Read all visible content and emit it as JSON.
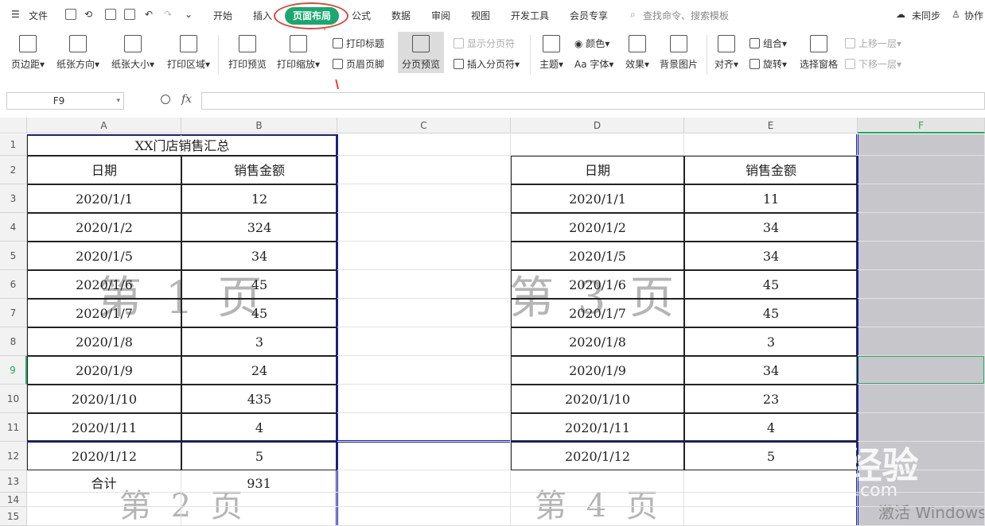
{
  "menu": {
    "file": "文件",
    "tabs": [
      "开始",
      "插入",
      "页面布局",
      "公式",
      "数据",
      "审阅",
      "视图",
      "开发工具",
      "会员专享"
    ],
    "search": "查找命令、搜索模板",
    "sync": "未同步",
    "collab": "协作"
  },
  "ribbon": {
    "margins": "页边距",
    "orientation": "纸张方向",
    "size": "纸张大小",
    "print_area": "打印区域",
    "print_preview": "打印预览",
    "print_scale": "打印缩放",
    "print_titles": "打印标题",
    "header_footer": "页眉页脚",
    "page_break_preview": "分页预览",
    "show_page_breaks": "显示分页符",
    "insert_page_break": "插入分页符",
    "theme": "主题",
    "colors": "颜色",
    "fonts": "字体",
    "effects": "效果",
    "background": "背景图片",
    "align": "对齐",
    "group": "组合",
    "rotate": "旋转",
    "selection_pane": "选择窗格",
    "bring_forward": "上移一层",
    "send_backward": "下移一层"
  },
  "formula_bar": {
    "name_box": "F9",
    "fx": "fx",
    "value": ""
  },
  "columns": [
    "A",
    "B",
    "C",
    "D",
    "E",
    "F"
  ],
  "rows": [
    "1",
    "2",
    "3",
    "4",
    "5",
    "6",
    "7",
    "8",
    "9",
    "10",
    "11",
    "12",
    "13",
    "14",
    "15"
  ],
  "table1": {
    "title": "XX门店销售汇总",
    "header_date": "日期",
    "header_amount": "销售金额",
    "dates": [
      "2020/1/1",
      "2020/1/2",
      "2020/1/5",
      "2020/1/6",
      "2020/1/7",
      "2020/1/8",
      "2020/1/9",
      "2020/1/10",
      "2020/1/11",
      "2020/1/12"
    ],
    "amounts": [
      "12",
      "324",
      "34",
      "45",
      "45",
      "3",
      "24",
      "435",
      "4",
      "5"
    ],
    "total_label": "合计",
    "total_value": "931"
  },
  "table2": {
    "header_date": "日期",
    "header_amount": "销售金额",
    "dates": [
      "2020/1/1",
      "2020/1/2",
      "2020/1/5",
      "2020/1/6",
      "2020/1/7",
      "2020/1/8",
      "2020/1/9",
      "2020/1/10",
      "2020/1/11",
      "2020/1/12"
    ],
    "amounts": [
      "11",
      "34",
      "34",
      "45",
      "45",
      "3",
      "34",
      "23",
      "4",
      "5"
    ]
  },
  "page_watermarks": [
    "第 1 页",
    "第 2 页",
    "第 3 页",
    "第 4 页"
  ],
  "watermark": {
    "logo": "Baidu经验",
    "url": "jingyan.baidu.com"
  },
  "windows_activate": "激活 Windows",
  "colors": {
    "accent": "#1aa86f",
    "page_break": "#1a1fb8",
    "selection": "#22a865",
    "annotation": "#e0443a"
  }
}
